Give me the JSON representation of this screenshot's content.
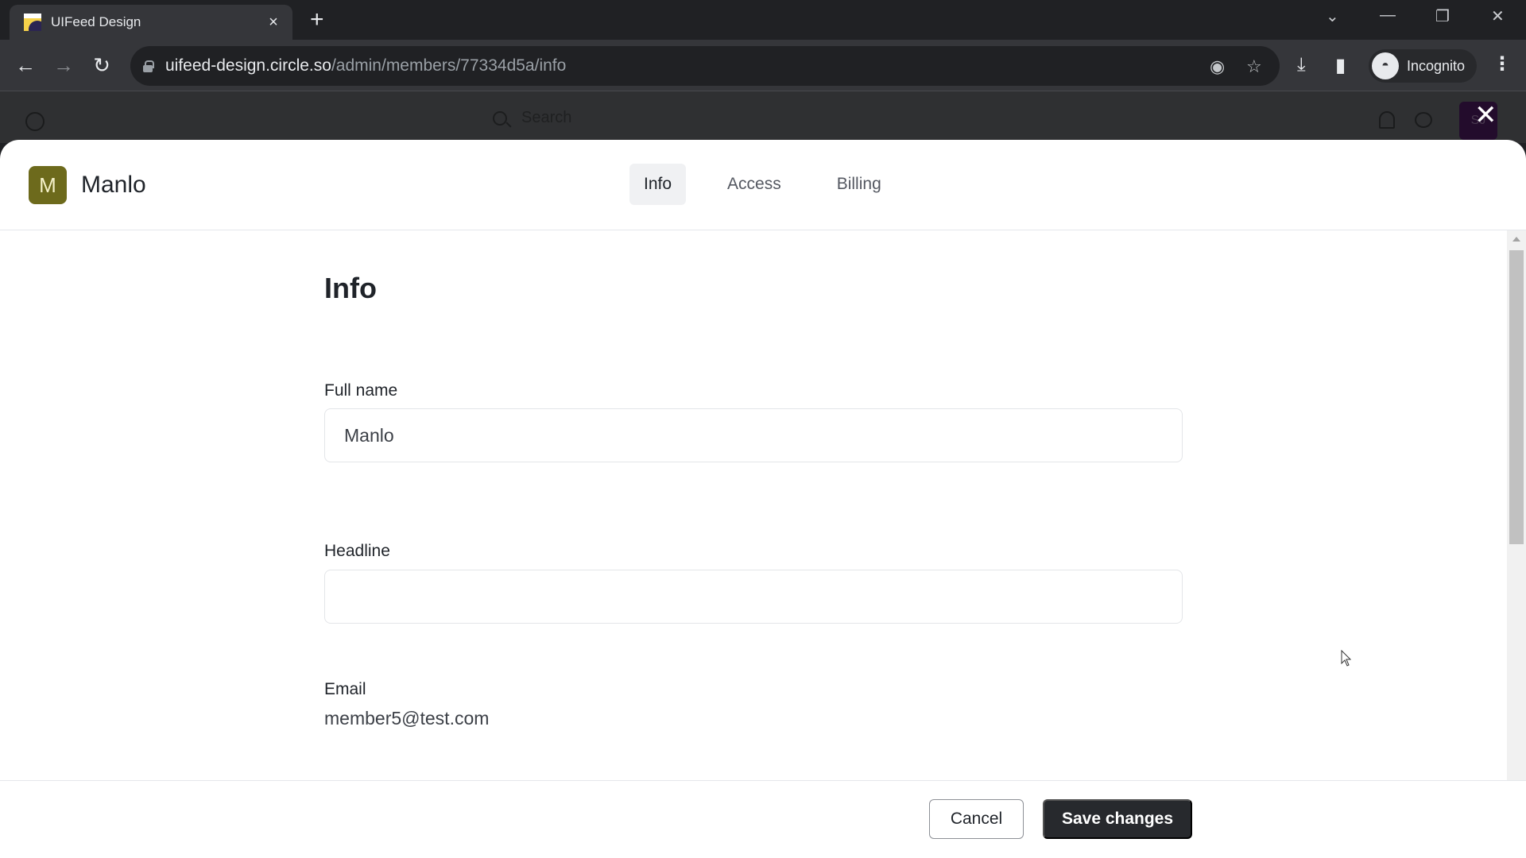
{
  "browser": {
    "tab_title": "UIFeed Design",
    "tab_close": "×",
    "new_tab": "+",
    "url_host": "uifeed-design.circle.so",
    "url_path": "/admin/members/77334d5a/info",
    "profile_label": "Incognito",
    "icons": {
      "back": "←",
      "forward": "→",
      "reload": "↻",
      "tab_search": "⌄",
      "minimize": "—",
      "restore": "❐",
      "close": "✕",
      "eye_off": "◉",
      "bookmark": "☆",
      "download": "⤓",
      "side_panel": "▮",
      "menu": "⋮",
      "incognito": "◓"
    }
  },
  "app_header": {
    "search_placeholder": "Search",
    "user_initials": "SJ",
    "close_glyph": "✕"
  },
  "modal": {
    "member_initial": "M",
    "member_name": "Manlo",
    "avatar_color": "#6d6a1c",
    "tabs": [
      {
        "label": "Info",
        "active": true
      },
      {
        "label": "Access",
        "active": false
      },
      {
        "label": "Billing",
        "active": false
      }
    ],
    "page_title": "Info",
    "fields": {
      "full_name": {
        "label": "Full name",
        "value": "Manlo"
      },
      "headline": {
        "label": "Headline",
        "value": ""
      },
      "email": {
        "label": "Email",
        "value": "member5@test.com"
      }
    },
    "footer": {
      "cancel_label": "Cancel",
      "save_label": "Save changes"
    }
  }
}
